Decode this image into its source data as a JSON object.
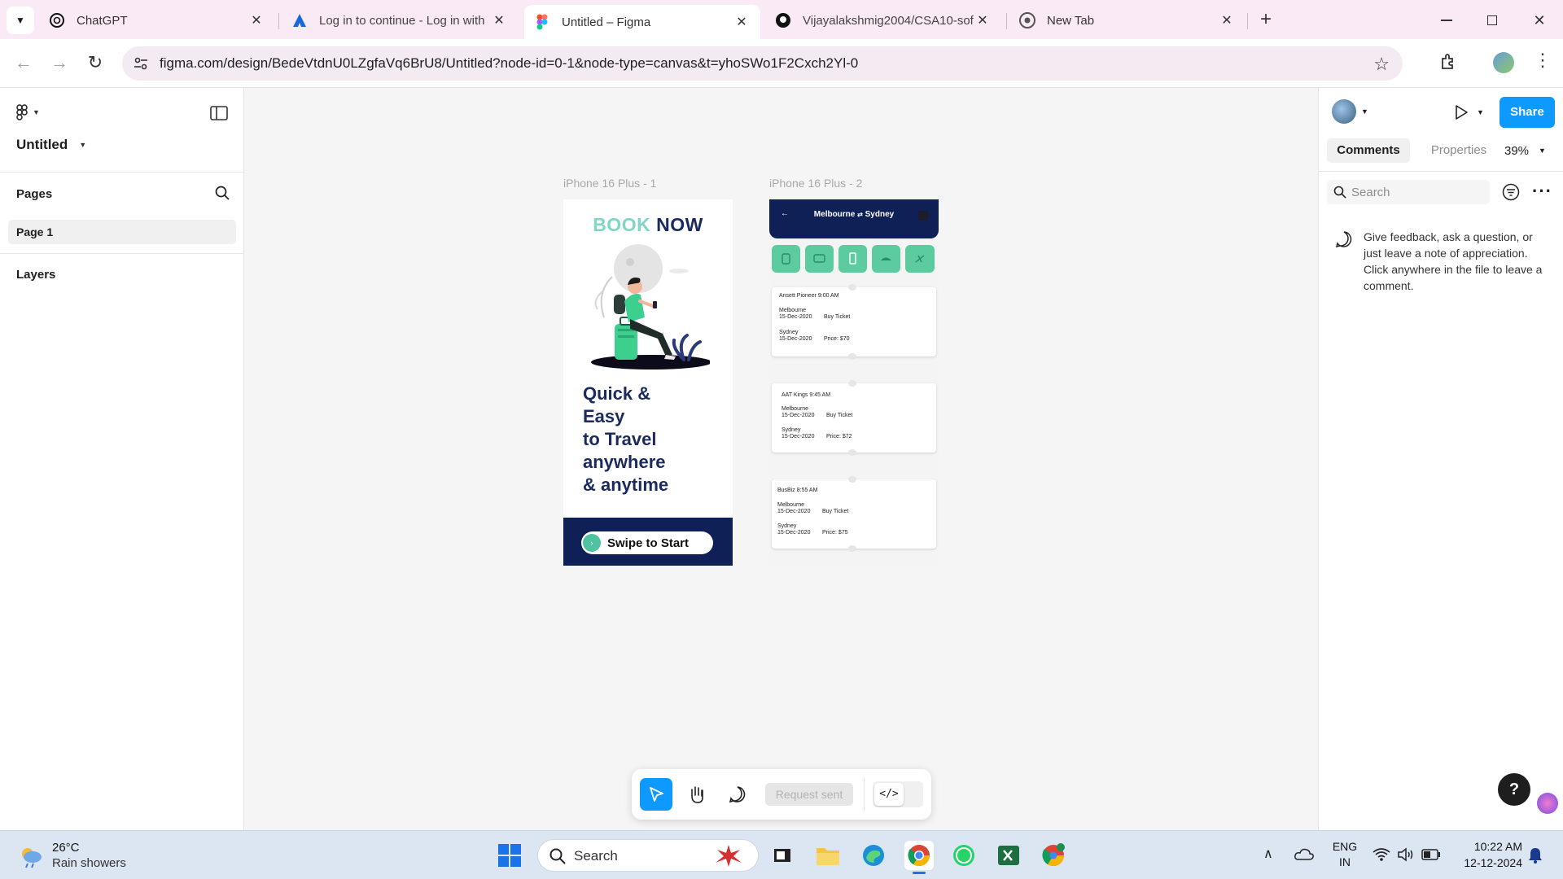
{
  "browser": {
    "tabs": [
      {
        "title": "ChatGPT",
        "icon": "chatgpt-icon",
        "active": false
      },
      {
        "title": "Log in to continue - Log in with",
        "icon": "atlassian-icon",
        "active": false
      },
      {
        "title": "Untitled – Figma",
        "icon": "figma-icon",
        "active": true
      },
      {
        "title": "Vijayalakshmig2004/CSA10-sof",
        "icon": "github-icon",
        "active": false
      },
      {
        "title": "New Tab",
        "icon": "chrome-icon",
        "active": false
      }
    ],
    "url": "figma.com/design/BedeVtdnU0LZgfaVq6BrU8/Untitled?node-id=0-1&node-type=canvas&t=yhoSWo1F2Cxch2Yl-0"
  },
  "figma": {
    "file_name": "Untitled",
    "pages_label": "Pages",
    "page_item": "Page 1",
    "layers_label": "Layers",
    "right": {
      "share_label": "Share",
      "tab_comments": "Comments",
      "tab_properties": "Properties",
      "zoom": "39%",
      "search_placeholder": "Search",
      "comment_hint": "Give feedback, ask a question, or just leave a note of appreciation. Click anywhere in the file to leave a comment."
    },
    "toolbar": {
      "request_label": "Request sent"
    },
    "frame1": {
      "label": "iPhone 16 Plus - 1",
      "book": "BOOK",
      "now": "NOW",
      "headline": [
        "Quick &",
        "Easy",
        "to Travel",
        "anywhere",
        "& anytime"
      ],
      "swipe": "Swipe to Start"
    },
    "frame2": {
      "label": "iPhone 16 Plus - 2",
      "route_from": "Melbourne",
      "route_arrow": "⇄",
      "route_to": "Sydney",
      "tickets": [
        {
          "header": "Ansett Pioneer  9:00 AM",
          "from": "Melbourne",
          "date1": "15-Dec-2020",
          "buy": "Buy Ticket",
          "to": "Sydney",
          "date2": "15-Dec-2020",
          "price": "Price: $70"
        },
        {
          "header": "AAT Kings  9:45 AM",
          "from": "Melbourne",
          "date1": "15-Dec-2020",
          "buy": "Buy Ticket",
          "to": "Sydney",
          "date2": "15-Dec-2020",
          "price": "Price: $72"
        },
        {
          "header": "BusBiz  8:55 AM",
          "from": "Melbourne",
          "date1": "15-Dec-2020",
          "buy": "Buy Ticket",
          "to": "Sydney",
          "date2": "15-Dec-2020",
          "price": "Price: $75"
        }
      ]
    }
  },
  "taskbar": {
    "weather_temp": "26°C",
    "weather_desc": "Rain showers",
    "search_placeholder": "Search",
    "lang_top": "ENG",
    "lang_bottom": "IN",
    "time": "10:22 AM",
    "date": "12-12-2024"
  },
  "colors": {
    "figma_blue": "#0d99ff",
    "navy": "#0f2057",
    "teal": "#5ccba0",
    "tab_strip": "#f9eaf6"
  }
}
